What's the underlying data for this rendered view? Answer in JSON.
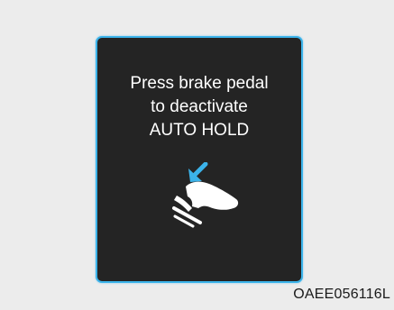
{
  "display": {
    "message_lines": [
      "Press brake pedal",
      "to deactivate",
      "AUTO HOLD"
    ],
    "icon": "brake-pedal-press-icon",
    "colors": {
      "background": "#242424",
      "border": "#3bb3ea",
      "text": "#ffffff",
      "arrow": "#3bb3ea"
    }
  },
  "image_code": "OAEE056116L"
}
